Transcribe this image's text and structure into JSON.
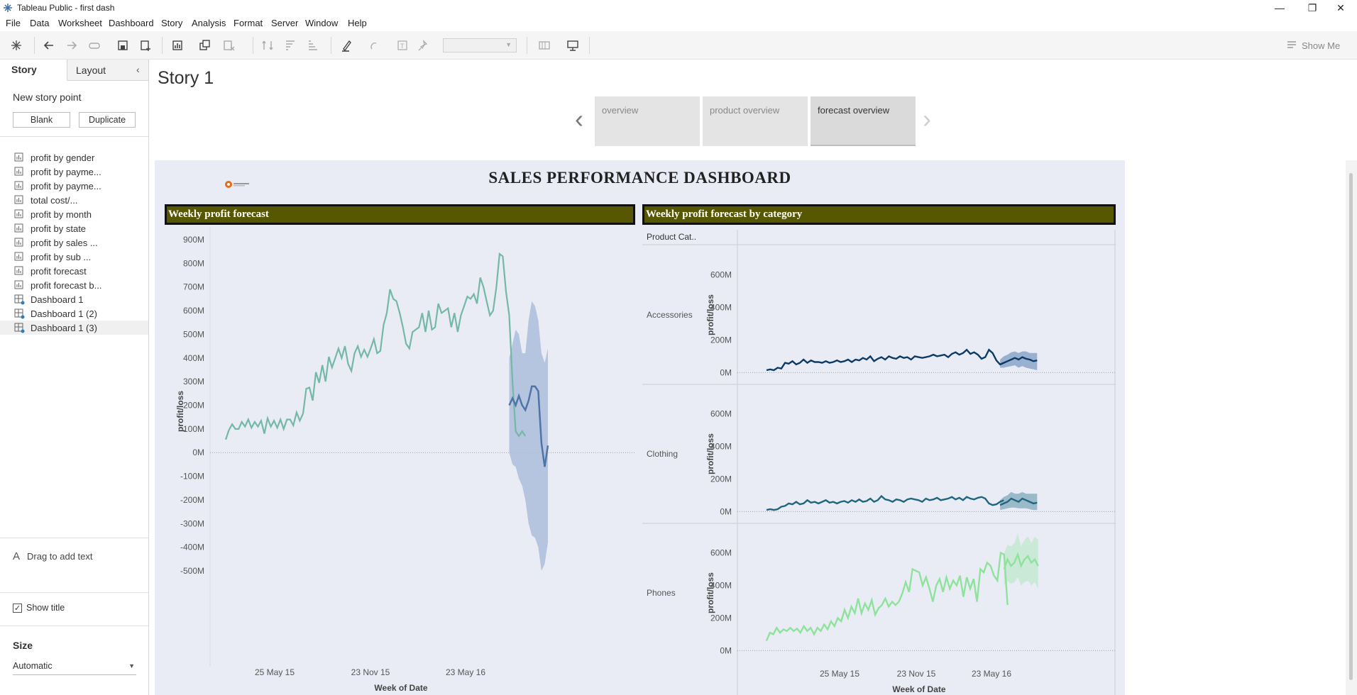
{
  "window": {
    "title": "Tableau Public - first dash"
  },
  "menu": [
    "File",
    "Data",
    "Worksheet",
    "Dashboard",
    "Story",
    "Analysis",
    "Format",
    "Server",
    "Window",
    "Help"
  ],
  "toolbar": {
    "show_me": "Show Me"
  },
  "sidebar": {
    "tabs": {
      "story": "Story",
      "layout": "Layout"
    },
    "new_story_point": "New story point",
    "blank": "Blank",
    "duplicate": "Duplicate",
    "items": [
      {
        "label": "profit by gender",
        "type": "sheet"
      },
      {
        "label": "profit by payme...",
        "type": "sheet"
      },
      {
        "label": "profit by payme...",
        "type": "sheet"
      },
      {
        "label": "total cost/...",
        "type": "sheet"
      },
      {
        "label": "profit by month",
        "type": "sheet"
      },
      {
        "label": "profit by state",
        "type": "sheet"
      },
      {
        "label": "profit by sales ...",
        "type": "sheet"
      },
      {
        "label": "profit by sub ...",
        "type": "sheet"
      },
      {
        "label": "profit forecast",
        "type": "sheet"
      },
      {
        "label": "profit forecast b...",
        "type": "sheet"
      },
      {
        "label": "Dashboard 1",
        "type": "dashboard"
      },
      {
        "label": "Dashboard 1 (2)",
        "type": "dashboard"
      },
      {
        "label": "Dashboard 1 (3)",
        "type": "dashboard"
      }
    ],
    "drag_text": "Drag to add text",
    "show_title": "Show title",
    "size_label": "Size",
    "size_value": "Automatic"
  },
  "story": {
    "title": "Story 1",
    "points": [
      {
        "label": "overview",
        "active": false
      },
      {
        "label": "product overview",
        "active": false
      },
      {
        "label": "forecast overview",
        "active": true
      }
    ]
  },
  "dashboard": {
    "title": "SALES PERFORMANCE DASHBOARD",
    "left_title": "Weekly profit forecast",
    "right_title": "Weekly profit forecast by category",
    "category_header": "Product Cat.."
  },
  "chart_data": [
    {
      "type": "line",
      "title": "Weekly profit forecast",
      "xlabel": "Week of Date",
      "ylabel": "profit/loss",
      "x_ticks": [
        "25 May 15",
        "23 Nov 15",
        "23 May 16"
      ],
      "y_ticks": [
        "900M",
        "800M",
        "700M",
        "600M",
        "500M",
        "400M",
        "300M",
        "200M",
        "100M",
        "0M",
        "-100M",
        "-200M",
        "-300M",
        "-400M",
        "-500M"
      ],
      "ylim": [
        -500,
        900
      ],
      "y_unit": "M",
      "colors": {
        "actual": "#74b8a6",
        "forecast": "#4e74a8",
        "band": "#a9bbd9"
      },
      "series": [
        {
          "name": "actual",
          "start_week": 0,
          "values": [
            55,
            95,
            120,
            100,
            100,
            130,
            110,
            140,
            105,
            130,
            110,
            135,
            80,
            145,
            110,
            135,
            105,
            140,
            100,
            140,
            140,
            115,
            170,
            135,
            165,
            270,
            275,
            220,
            340,
            295,
            370,
            300,
            405,
            360,
            400,
            440,
            400,
            450,
            375,
            345,
            420,
            450,
            405,
            435,
            405,
            440,
            480,
            420,
            430,
            540,
            590,
            690,
            650,
            640,
            590,
            530,
            460,
            440,
            510,
            520,
            530,
            590,
            510,
            600,
            520,
            530,
            630,
            590,
            600,
            610,
            530,
            590,
            510,
            580,
            620,
            660,
            650,
            670,
            630,
            740,
            700,
            640,
            580,
            600,
            700,
            840,
            830,
            680,
            580,
            300,
            90,
            70,
            90,
            70
          ]
        },
        {
          "name": "forecast",
          "start_week": 88,
          "values": [
            200,
            230,
            200,
            240,
            200,
            180,
            220,
            280,
            280,
            260,
            40,
            -60,
            30
          ]
        },
        {
          "name": "forecast upper",
          "start_week": 88,
          "values": [
            400,
            460,
            520,
            500,
            420,
            420,
            560,
            640,
            620,
            560,
            420,
            380,
            440
          ]
        },
        {
          "name": "forecast lower",
          "start_week": 88,
          "values": [
            0,
            -50,
            -60,
            -110,
            -140,
            -200,
            -300,
            -350,
            -360,
            -400,
            -500,
            -470,
            -380
          ]
        }
      ]
    },
    {
      "type": "line",
      "title": "Weekly profit forecast by category",
      "xlabel": "Week of Date",
      "ylabel": "profit/loss",
      "x_ticks": [
        "25 May 15",
        "23 Nov 15",
        "23 May 16"
      ],
      "y_ticks": [
        "600M",
        "400M",
        "200M",
        "0M"
      ],
      "ylim": [
        -20,
        720
      ],
      "panels": [
        {
          "category": "Accessories",
          "color": "#0d3b66",
          "band_color": "#7e9cc6",
          "actual": [
            15,
            20,
            15,
            30,
            25,
            60,
            55,
            70,
            50,
            60,
            80,
            60,
            75,
            65,
            65,
            60,
            70,
            60,
            65,
            75,
            65,
            70,
            80,
            65,
            80,
            75,
            90,
            80,
            100,
            70,
            85,
            95,
            80,
            100,
            90,
            85,
            100,
            90,
            95,
            80,
            100,
            95,
            90,
            95,
            100,
            110,
            100,
            105,
            110,
            95,
            115,
            125,
            110,
            120,
            140,
            115,
            125,
            110,
            85,
            95,
            140,
            120,
            75,
            50,
            60
          ],
          "forecast": [
            50,
            60,
            70,
            80,
            90,
            80,
            95,
            85,
            80,
            70,
            75
          ],
          "upper": [
            80,
            100,
            110,
            125,
            130,
            120,
            130,
            130,
            120,
            120,
            120
          ],
          "lower": [
            30,
            30,
            35,
            40,
            45,
            30,
            40,
            30,
            25,
            20,
            15
          ]
        },
        {
          "category": "Clothing",
          "color": "#21667f",
          "band_color": "#7fa8bb",
          "actual": [
            10,
            15,
            10,
            15,
            30,
            35,
            50,
            45,
            60,
            45,
            50,
            70,
            55,
            60,
            50,
            60,
            70,
            55,
            60,
            50,
            60,
            65,
            55,
            70,
            60,
            75,
            60,
            65,
            80,
            60,
            70,
            95,
            75,
            70,
            60,
            75,
            70,
            60,
            75,
            80,
            75,
            70,
            60,
            80,
            70,
            75,
            85,
            70,
            75,
            80,
            90,
            75,
            85,
            70,
            90,
            80,
            75,
            85,
            90,
            80,
            50,
            40,
            45,
            60,
            70
          ],
          "forecast": [
            40,
            50,
            60,
            80,
            70,
            60,
            80,
            70,
            60,
            50,
            55
          ],
          "upper": [
            70,
            90,
            100,
            120,
            110,
            110,
            120,
            110,
            110,
            110,
            110
          ],
          "lower": [
            10,
            15,
            20,
            25,
            25,
            20,
            20,
            20,
            15,
            10,
            10
          ]
        },
        {
          "category": "Phones",
          "color": "#8ee39c",
          "band_color": "#bfe8cd",
          "actual": [
            60,
            110,
            100,
            140,
            110,
            130,
            120,
            140,
            120,
            135,
            110,
            150,
            120,
            140,
            100,
            140,
            120,
            160,
            130,
            180,
            150,
            200,
            180,
            250,
            200,
            270,
            230,
            320,
            230,
            290,
            250,
            310,
            220,
            260,
            280,
            320,
            270,
            300,
            280,
            300,
            350,
            420,
            360,
            500,
            490,
            480,
            400,
            450,
            380,
            300,
            400,
            440,
            360,
            450,
            380,
            430,
            400,
            460,
            330,
            450,
            380,
            440,
            300,
            500,
            480,
            540,
            520,
            460,
            430,
            600,
            590,
            280
          ],
          "forecast": [
            500,
            560,
            520,
            540,
            590,
            520,
            560,
            580,
            540,
            560,
            520
          ],
          "upper": [
            600,
            650,
            640,
            660,
            720,
            640,
            680,
            700,
            660,
            700,
            680
          ],
          "lower": [
            400,
            430,
            410,
            420,
            450,
            400,
            420,
            430,
            400,
            420,
            380
          ]
        }
      ]
    }
  ]
}
